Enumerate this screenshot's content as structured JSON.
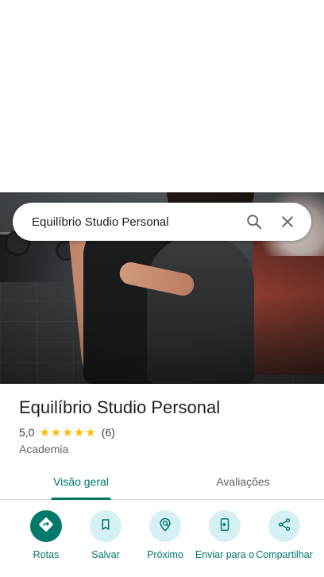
{
  "search": {
    "query": "Equilíbrio Studio Personal"
  },
  "place": {
    "name": "Equilíbrio Studio Personal",
    "rating": "5,0",
    "stars": 5,
    "review_count": "(6)",
    "category": "Academia"
  },
  "tabs": [
    {
      "label": "Visão geral",
      "active": true
    },
    {
      "label": "Avaliações",
      "active": false
    }
  ],
  "actions": [
    {
      "label": "Rotas",
      "icon": "directions-icon"
    },
    {
      "label": "Salvar",
      "icon": "bookmark-icon"
    },
    {
      "label": "Próximo",
      "icon": "nearby-icon"
    },
    {
      "label": "Enviar para o",
      "icon": "send-to-phone-icon"
    },
    {
      "label": "Compartilhar",
      "icon": "share-icon"
    }
  ],
  "colors": {
    "accent": "#00796b",
    "action_bg": "#d6f1f3",
    "star": "#fbbc04"
  }
}
